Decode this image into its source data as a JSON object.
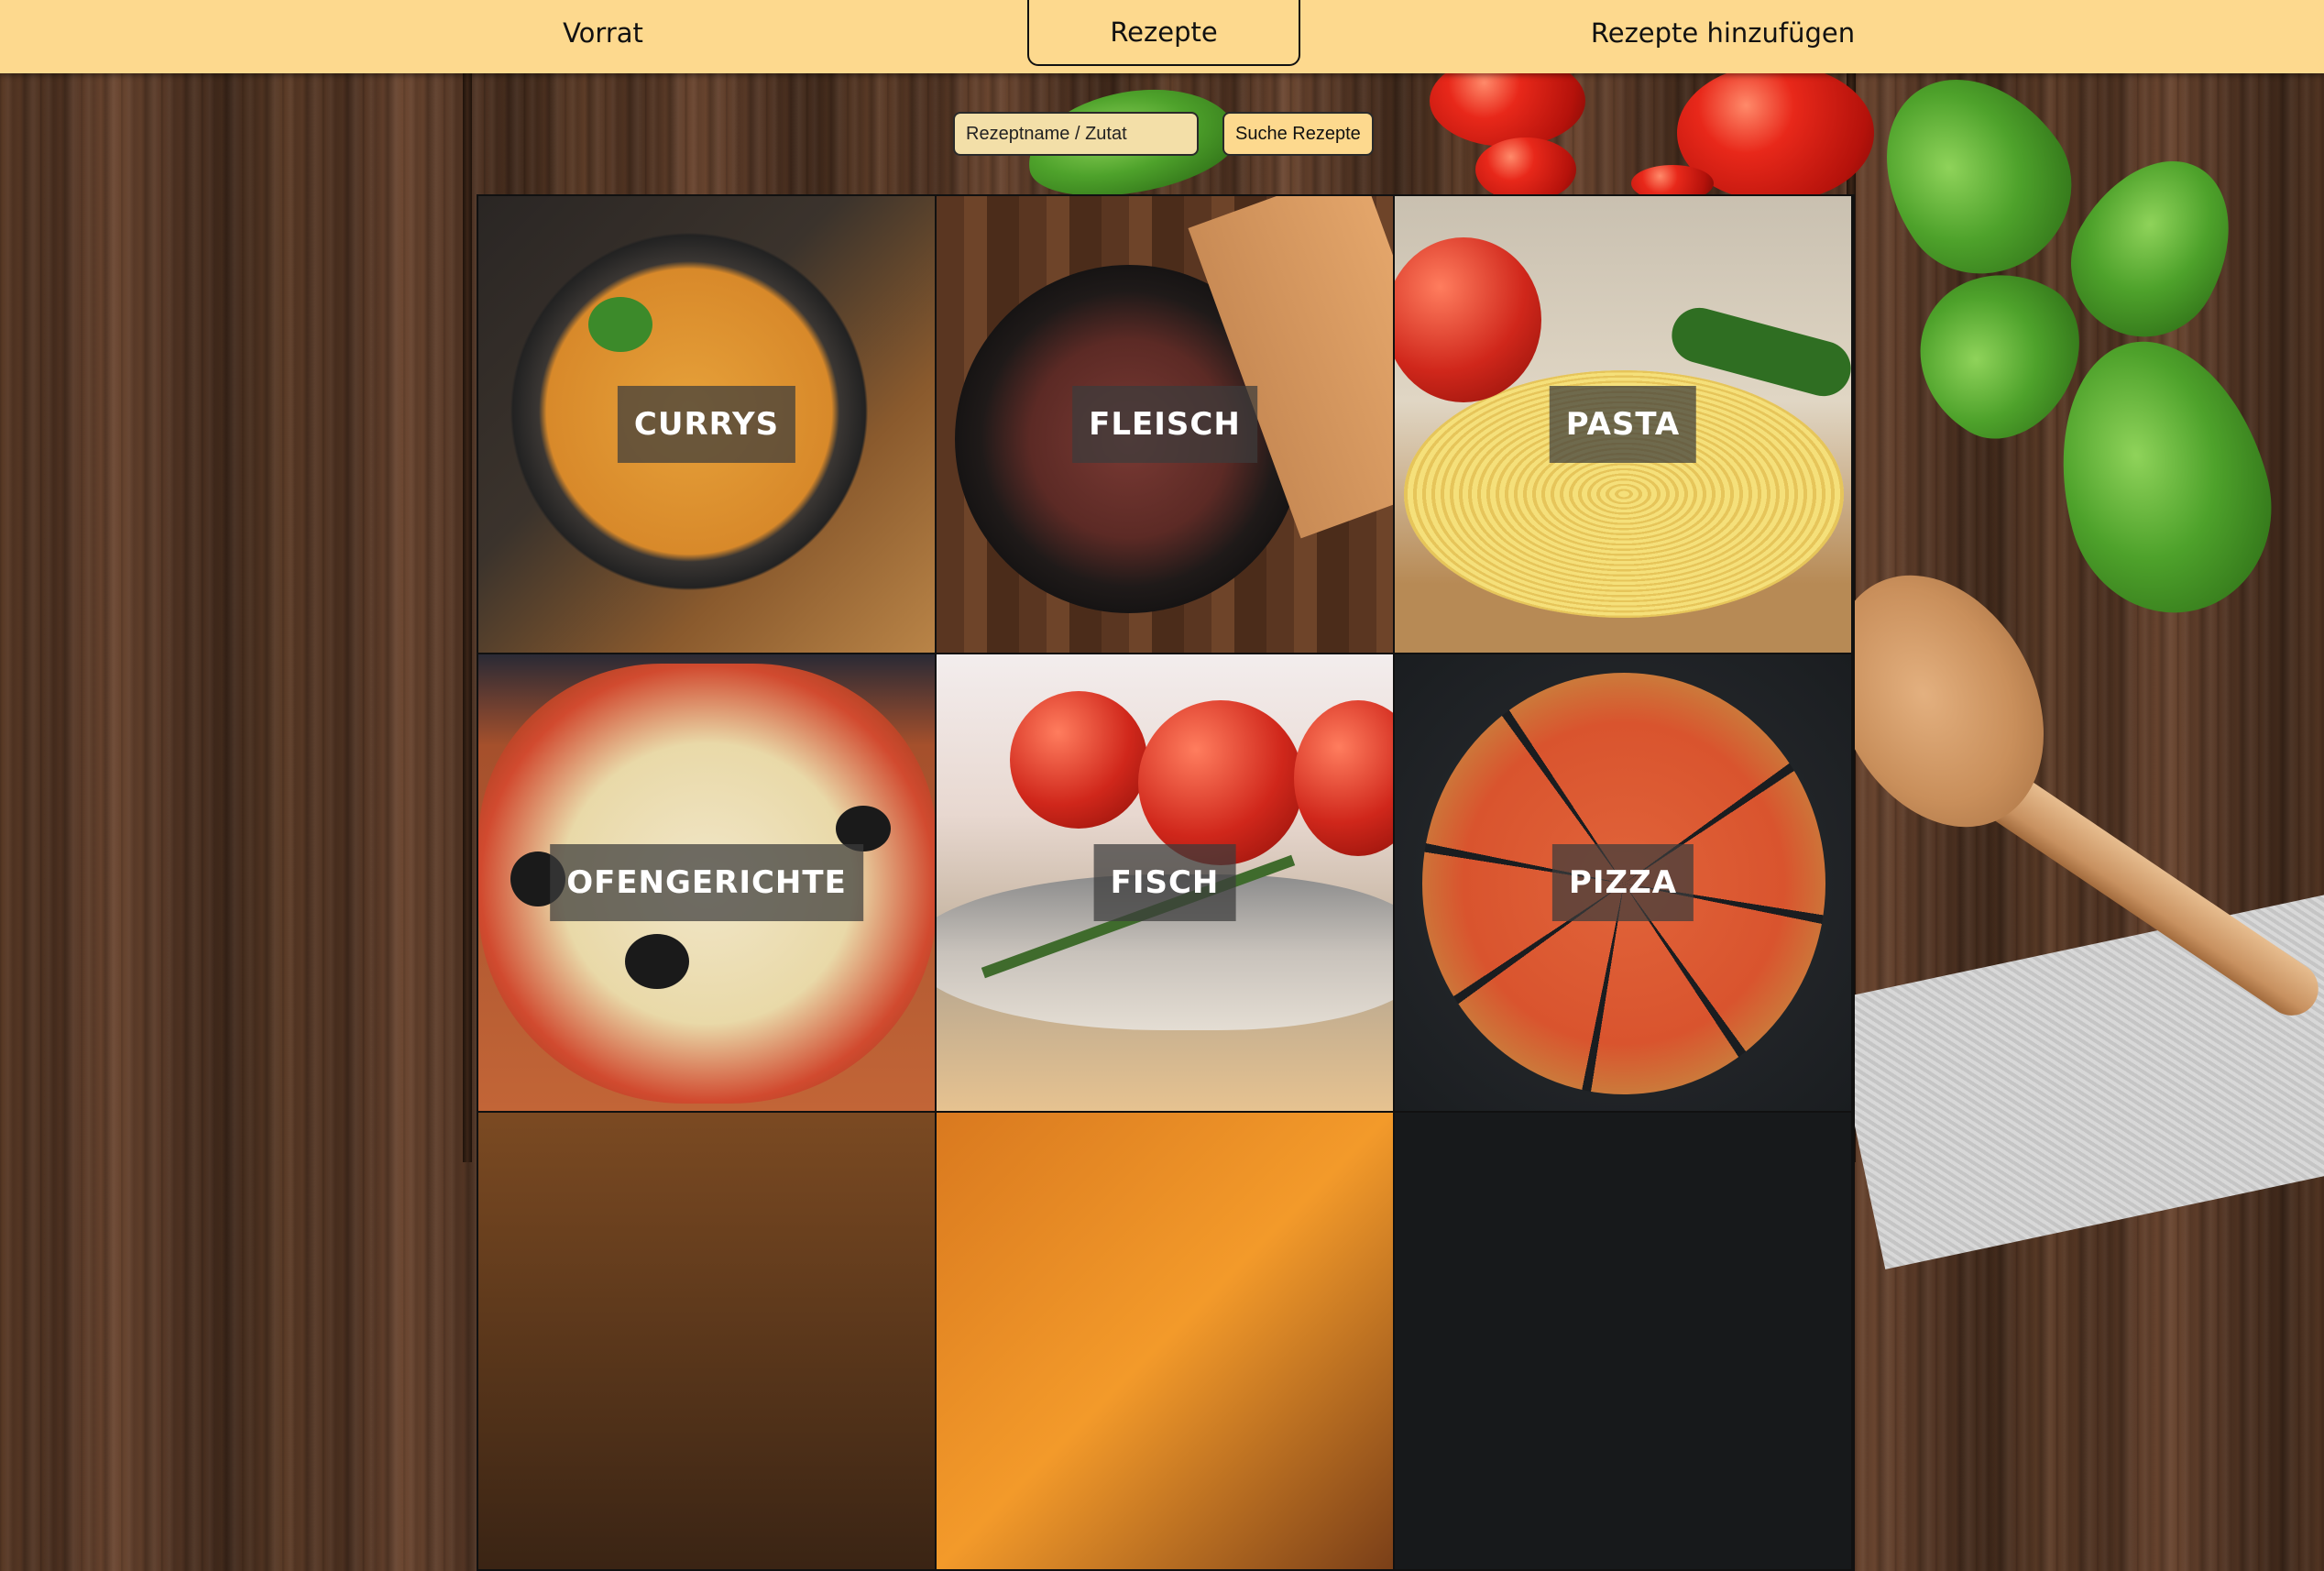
{
  "nav": {
    "items": [
      {
        "label": "Vorrat"
      },
      {
        "label": "Rezepte",
        "active": true
      },
      {
        "label": "Rezepte hinzufügen"
      }
    ]
  },
  "search": {
    "placeholder": "Rezeptname / Zutat",
    "value": "",
    "button_label": "Suche Rezepte"
  },
  "categories": [
    {
      "label": "CURRYS",
      "icon": "curry-bowl"
    },
    {
      "label": "FLEISCH",
      "icon": "steak-plate"
    },
    {
      "label": "PASTA",
      "icon": "tagliatelle"
    },
    {
      "label": "OFENGERICHTE",
      "icon": "casserole"
    },
    {
      "label": "FISCH",
      "icon": "fish"
    },
    {
      "label": "PIZZA",
      "icon": "pizza"
    }
  ],
  "colors": {
    "navbar": "#fdd98e",
    "search_input_bg": "#f3dfa8",
    "label_overlay": "rgba(60,60,60,0.72)"
  }
}
